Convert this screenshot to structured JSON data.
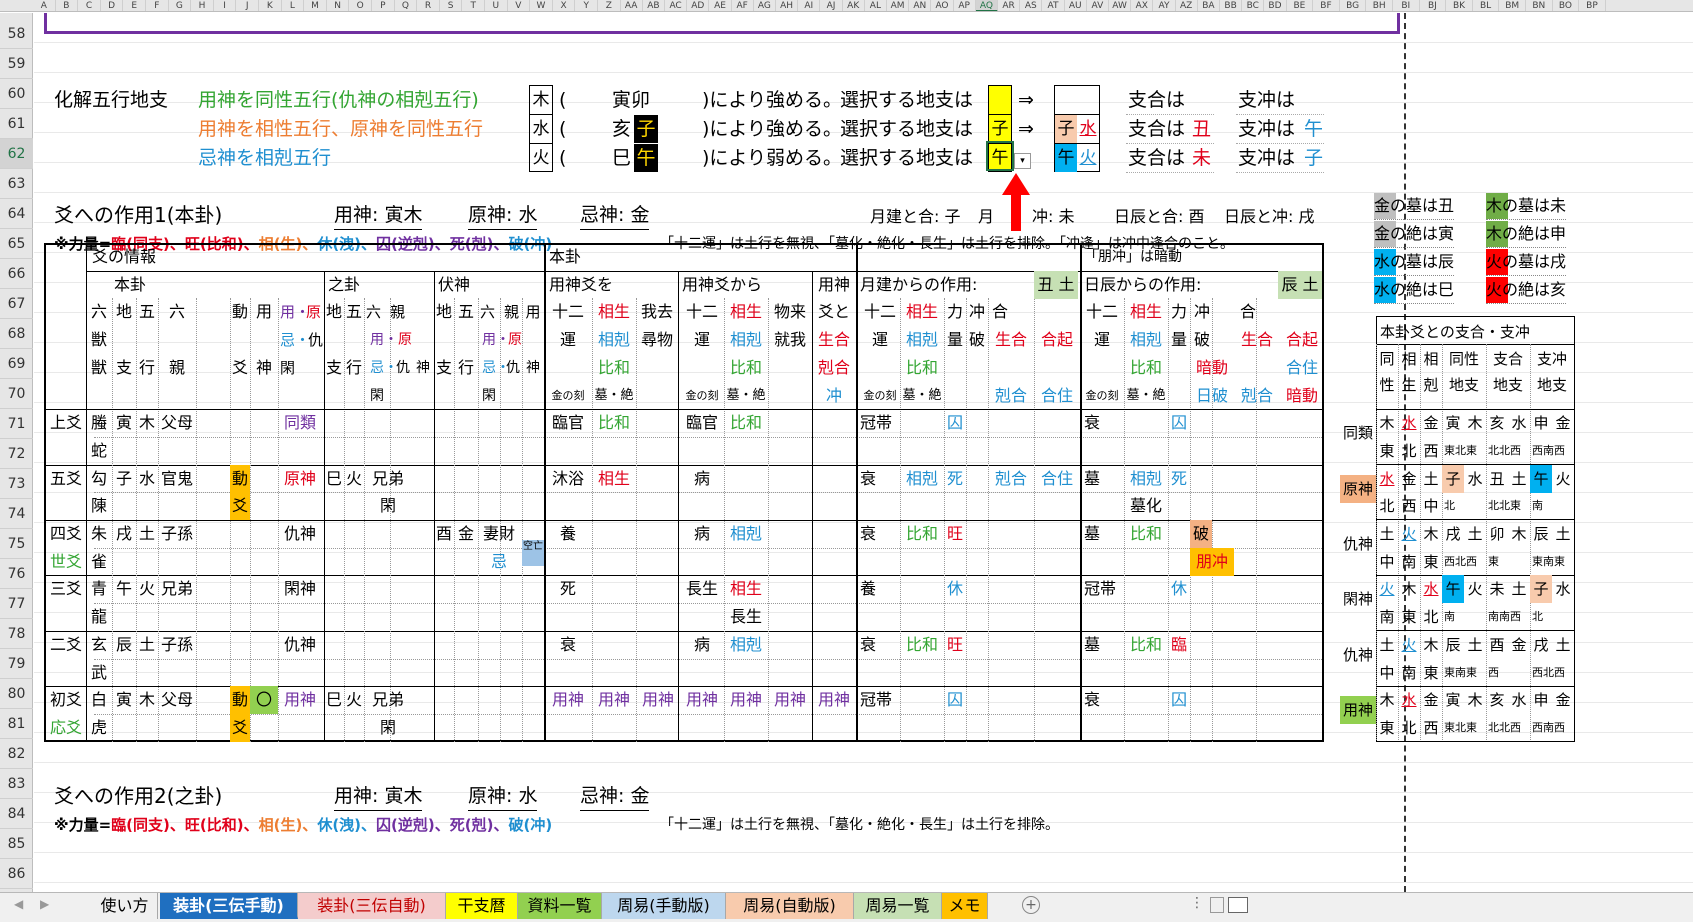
{
  "headers": {
    "columns": [
      "A",
      "B",
      "C",
      "D",
      "E",
      "F",
      "G",
      "H",
      "I",
      "J",
      "K",
      "L",
      "M",
      "N",
      "O",
      "P",
      "Q",
      "R",
      "S",
      "T",
      "U",
      "V",
      "W",
      "X",
      "Y",
      "Z",
      "AA",
      "AB",
      "AC",
      "AD",
      "AE",
      "AF",
      "AG",
      "AH",
      "AI",
      "AJ",
      "AK",
      "AL",
      "AM",
      "AN",
      "AO",
      "AP",
      "AQ",
      "AR",
      "AS",
      "AT",
      "AU",
      "AV",
      "AW",
      "AX",
      "AY",
      "AZ",
      "BA",
      "BB",
      "BC",
      "BD",
      "BE",
      "BF",
      "BG",
      "BH",
      "BI",
      "BJ",
      "BK",
      "BL",
      "BM",
      "BN",
      "BO",
      "BP"
    ],
    "rows": [
      "58",
      "59",
      "60",
      "61",
      "62",
      "63",
      "64",
      "65",
      "66",
      "67",
      "68",
      "69",
      "70",
      "71",
      "72",
      "73",
      "74",
      "75",
      "76",
      "77",
      "78",
      "79",
      "80",
      "81",
      "82",
      "83",
      "84",
      "85",
      "86"
    ]
  },
  "kaige": {
    "label": "化解五行地支",
    "r60": {
      "desc": "用神を同性五行(仇神の相剋五行)",
      "el": "木",
      "open": "(",
      "br": "寅卯",
      "close": ")により強める。",
      "sel": "選択する地支は",
      "arrow": "⇒",
      "shigo": "支合は",
      "shichu": "支冲は"
    },
    "r61": {
      "desc": "用神を相性五行、原神を同性五行",
      "el": "水",
      "open": "(",
      "br1": "亥",
      "br2": "子",
      "close": ")により強める。",
      "sel": "選択する地支は",
      "v": "子",
      "arrow": "⇒",
      "o1": "子",
      "o2": "水",
      "shigo": "支合は",
      "shigov": "丑",
      "shichu": "支冲は",
      "shichuv": "午"
    },
    "r62": {
      "desc": "忌神を相剋五行",
      "el": "火",
      "open": "(",
      "br1": "巳",
      "br2": "午",
      "close": ")により弱める。",
      "sel": "選択する地支は",
      "v": "午",
      "o1": "午",
      "o2": "火",
      "shigo": "支合は",
      "shigov": "未",
      "shichu": "支冲は",
      "shichuv": "子"
    }
  },
  "s1": {
    "title": "爻への作用1(本卦)",
    "yojin": "用神: 寅木",
    "genjin": "原神: 水",
    "kijin": "忌神: 金",
    "getsu": "月建と合: 子",
    "getsu_chu_a": "月",
    "getsu_chu_b": "冲: 未",
    "nichi": "日辰と合: 酉",
    "nichi_chu": "日辰と冲: 戌",
    "note1": "※力量=",
    "note2": "臨(同支)、",
    "note3": "旺(比和)、",
    "note4": "相(生)、",
    "note5": "休(洩)、",
    "note6": "囚(逆剋)、",
    "note7": "死(剋)、",
    "note8": "破(冲)",
    "note9": "「十二運」は土行を無視、「墓化・絶化・長生」は土行を排除。「冲逢」は冲中逢合のこと。"
  },
  "legend": [
    {
      "t": "金の墓は丑",
      "bg": "#bfbfbf",
      "fg": "#000"
    },
    {
      "t": "木の墓は未",
      "bg": "#70ad47",
      "fg": "#000"
    },
    {
      "t": "金の絶は寅",
      "bg": "#bfbfbf",
      "fg": "#000"
    },
    {
      "t": "木の絶は申",
      "bg": "#70ad47",
      "fg": "#000"
    },
    {
      "t": "水の墓は辰",
      "bg": "#00b0f0",
      "fg": "#000"
    },
    {
      "t": "火の墓は戌",
      "bg": "#ff0000",
      "fg": "#000"
    },
    {
      "t": "水の絶は巳",
      "bg": "#00b0f0",
      "fg": "#000"
    },
    {
      "t": "火の絶は亥",
      "bg": "#ff0000",
      "fg": "#000"
    }
  ],
  "main": {
    "h_info": "爻の情報",
    "h_honka": "本卦",
    "h_houchu": "「朋冲」は暗動",
    "h_hon": "本卦",
    "h_shi": "之卦",
    "h_fuku": "伏神",
    "h_yojinwo": "用神爻を",
    "h_yojinkara": "用神爻から",
    "h_yojinto1": "用神",
    "h_yojinto2": "爻と",
    "h_getsu": "月建からの作用:",
    "h_getsu_v": "丑 土",
    "h_nichi": "日辰からの作用:",
    "h_nichi_v": "辰 土",
    "c1": [
      "六",
      "獣"
    ],
    "c2": [
      "地",
      "支"
    ],
    "c3": [
      "五",
      "行"
    ],
    "c4": [
      "六",
      "親"
    ],
    "c5": [
      "動",
      "爻"
    ],
    "c6": [
      "用",
      "神"
    ],
    "c7a": "用・",
    "c7b": "原",
    "c7c": "忌・",
    "c7d": "仇",
    "c7e": "閑",
    "c8": [
      "地",
      "支"
    ],
    "c9": [
      "五",
      "行"
    ],
    "c10a": "六",
    "c10b": "親",
    "c10c": "用・",
    "c10d": "原",
    "c10e": "忌・",
    "c10f": "仇",
    "c10g": "神",
    "c10h": "閑",
    "c11": [
      "地",
      "支"
    ],
    "c12": [
      "五",
      "行"
    ],
    "c13a": "六",
    "c13b": "親",
    "c13c": "用・",
    "c13d": "原",
    "c13e": "忌・",
    "c13f": "仇",
    "c13g": "神",
    "c13h": "閑",
    "c14": "用",
    "k_juni": [
      "十二",
      "運",
      "金の刻"
    ],
    "k_sho": [
      "相生",
      "相剋",
      "比和",
      "墓・絶"
    ],
    "k_gakyo": [
      "我去",
      "尋物"
    ],
    "k_juni2": [
      "十二",
      "運",
      "金の刻"
    ],
    "k_sho2": [
      "相生",
      "相剋",
      "比和",
      "墓・絶"
    ],
    "k_buttsu": [
      "物来",
      "就我"
    ],
    "k_aito": [
      "生合",
      "剋合",
      "冲"
    ],
    "g_juni": [
      "十二",
      "運",
      "金の刻"
    ],
    "g_sho": [
      "相生",
      "相剋",
      "比和",
      "墓・絶"
    ],
    "g_ri": [
      "力",
      "量"
    ],
    "g_chu": [
      "冲",
      "破"
    ],
    "g_go": "合",
    "g_sei": "生合",
    "g_goki": "合起",
    "g_koku": "剋合",
    "g_goju": "合住",
    "n_juni": [
      "十二",
      "運",
      "金の刻"
    ],
    "n_sho": [
      "相生",
      "相剋",
      "比和",
      "墓・絶"
    ],
    "n_ri": [
      "力",
      "量"
    ],
    "n_chu": [
      "冲",
      "破",
      "暗動",
      "日破"
    ],
    "n_go": "合",
    "n_sei": "生合",
    "n_goki": "合起",
    "n_goju": "合住",
    "n_ando": "暗動",
    "n_koku": "剋合",
    "rows": [
      {
        "pos": "上爻",
        "pos2": "",
        "ju": [
          "螣",
          "蛇"
        ],
        "br": "寅",
        "el": "木",
        "rk": "父母",
        "role": "同類",
        "rolec": "purple",
        "k12": "臨官",
        "kr": "比和",
        "krc": "green",
        "b12": "臨官",
        "br2": "比和",
        "br2c": "green",
        "g12": "冠帯",
        "gr": "",
        "gl": "囚",
        "glc": "blue",
        "n12": "衰",
        "nl": "囚",
        "nlc": "blue"
      },
      {
        "pos": "五爻",
        "pos2": "",
        "ju": [
          "勾",
          "陳"
        ],
        "br": "子",
        "el": "水",
        "rk": "官鬼",
        "dou": [
          "動",
          "爻"
        ],
        "role": "原神",
        "rolec": "red",
        "sbr": "巳",
        "sel": "火",
        "srk": [
          "兄弟",
          "閑"
        ],
        "k12": "沐浴",
        "kr": "相生",
        "krc": "red",
        "b12": "病",
        "g12": "衰",
        "gr": "相剋",
        "grc": "blue",
        "gl": "死",
        "glc": "blue",
        "gkg": "剋合",
        "ggj": "合住",
        "n12": "墓",
        "nr": "相剋",
        "nrc": "blue",
        "nr2": "墓化",
        "nl": "死",
        "nlc": "blue"
      },
      {
        "pos": "四爻",
        "pos2": "世爻",
        "ju": [
          "朱",
          "雀"
        ],
        "br": "戌",
        "el": "土",
        "rk": "子孫",
        "role": "仇神",
        "rolec": "black",
        "fbr": "酉",
        "fel": "金",
        "frk": [
          "妻財",
          "忌"
        ],
        "kuu": "空亡",
        "k12": "養",
        "b12": "病",
        "br2": "相剋",
        "br2c": "blue",
        "g12": "衰",
        "gr": "比和",
        "grc": "green",
        "gl": "旺",
        "glc": "red",
        "n12": "墓",
        "nr": "比和",
        "nrc": "green",
        "nchu": [
          "破",
          "朋冲"
        ]
      },
      {
        "pos": "三爻",
        "pos2": "",
        "ju": [
          "青",
          "龍"
        ],
        "br": "午",
        "el": "火",
        "rk": "兄弟",
        "role": "閑神",
        "rolec": "black",
        "k12": "死",
        "b12": "長生",
        "br2": "相生",
        "br2c": "red",
        "br3": "長生",
        "g12": "養",
        "gl": "休",
        "glc": "blue",
        "n12": "冠帯",
        "nl": "休",
        "nlc": "blue"
      },
      {
        "pos": "二爻",
        "pos2": "",
        "ju": [
          "玄",
          "武"
        ],
        "br": "辰",
        "el": "土",
        "rk": "子孫",
        "role": "仇神",
        "rolec": "black",
        "k12": "衰",
        "b12": "病",
        "br2": "相剋",
        "br2c": "blue",
        "g12": "衰",
        "gr": "比和",
        "grc": "green",
        "gl": "旺",
        "glc": "red",
        "n12": "墓",
        "nr": "比和",
        "nrc": "green",
        "nl": "臨",
        "nlc": "red"
      },
      {
        "pos": "初爻",
        "pos2": "応爻",
        "ju": [
          "白",
          "虎"
        ],
        "br": "寅",
        "el": "木",
        "rk": "父母",
        "dou": [
          "動",
          "爻"
        ],
        "yo": "〇",
        "role": "用神",
        "rolec": "purple",
        "sbr": "巳",
        "sel": "火",
        "srk": [
          "兄弟",
          "閑"
        ],
        "yall": "用神",
        "g12": "冠帯",
        "gl": "囚",
        "glc": "blue",
        "n12": "衰",
        "nl": "囚",
        "nlc": "blue"
      }
    ]
  },
  "right": {
    "title": "本卦爻との支合・支冲",
    "h": [
      "同性",
      "相生",
      "相剋",
      "同性地支",
      "支合地支",
      "支冲地支"
    ],
    "rows": [
      {
        "role": "同類",
        "a": [
          "木",
          "東"
        ],
        "b": [
          "水",
          "北"
        ],
        "c": [
          "金",
          "西"
        ],
        "d": [
          "寅",
          "木",
          "東北東"
        ],
        "e": [
          "亥",
          "水",
          "北北西"
        ],
        "f": [
          "申",
          "金",
          "西南西"
        ]
      },
      {
        "role": "原神",
        "a": [
          "水",
          "北"
        ],
        "b": [
          "金",
          "西"
        ],
        "c": [
          "土",
          "中"
        ],
        "d": [
          "子",
          "水",
          "北"
        ],
        "e": [
          "丑",
          "土",
          "北北東"
        ],
        "f": [
          "午",
          "火",
          "南"
        ]
      },
      {
        "role": "仇神",
        "a": [
          "土",
          "中"
        ],
        "b": [
          "火",
          "南"
        ],
        "c": [
          "木",
          "東"
        ],
        "d": [
          "戌",
          "土",
          "西北西"
        ],
        "e": [
          "卯",
          "木",
          "東"
        ],
        "f": [
          "辰",
          "土",
          "東南東"
        ]
      },
      {
        "role": "閑神",
        "a": [
          "火",
          "南"
        ],
        "b": [
          "木",
          "東"
        ],
        "c": [
          "水",
          "北"
        ],
        "d": [
          "午",
          "火",
          "南"
        ],
        "e": [
          "未",
          "土",
          "南南西"
        ],
        "f": [
          "子",
          "水",
          "北"
        ]
      },
      {
        "role": "仇神",
        "a": [
          "土",
          "中"
        ],
        "b": [
          "火",
          "南"
        ],
        "c": [
          "木",
          "東"
        ],
        "d": [
          "辰",
          "土",
          "東南東"
        ],
        "e": [
          "酉",
          "金",
          "西"
        ],
        "f": [
          "戌",
          "土",
          "西北西"
        ]
      },
      {
        "role": "用神",
        "a": [
          "木",
          "東"
        ],
        "b": [
          "水",
          "北"
        ],
        "c": [
          "金",
          "西"
        ],
        "d": [
          "寅",
          "木",
          "東北東"
        ],
        "e": [
          "亥",
          "水",
          "北北西"
        ],
        "f": [
          "申",
          "金",
          "西南西"
        ]
      }
    ]
  },
  "s2": {
    "title": "爻への作用2(之卦)",
    "yojin": "用神: 寅木",
    "genjin": "原神: 水",
    "kijin": "忌神: 金",
    "note": "「十二運」は土行を無視、「墓化・絶化・長生」は土行を排除。"
  },
  "tabs": [
    "使い方",
    "装卦(三伝手動)",
    "装卦(三伝自動)",
    "干支暦",
    "資料一覧",
    "周易(手動版)",
    "周易(自動版)",
    "周易一覧",
    "メモ"
  ]
}
